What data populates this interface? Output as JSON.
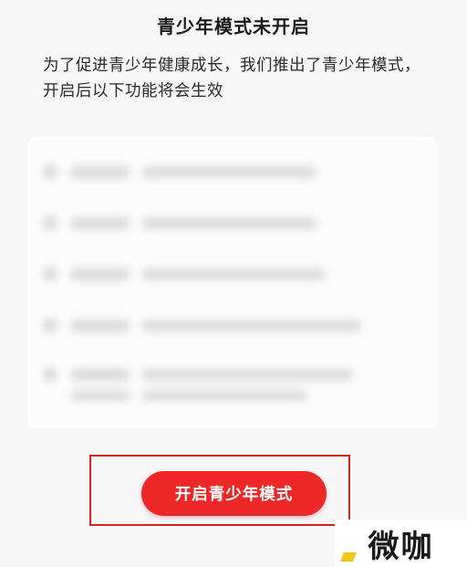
{
  "modal": {
    "title": "青少年模式未开启",
    "description": "为了促进青少年健康成长，我们推出了青少年模式，开启后以下功能将会生效",
    "feature_list_blurred": true,
    "cta_label": "开启青少年模式"
  },
  "watermark": {
    "text": "微咖"
  },
  "colors": {
    "accent": "#ee2728",
    "highlight_border": "#d9221c",
    "background": "#f6f6f6"
  }
}
